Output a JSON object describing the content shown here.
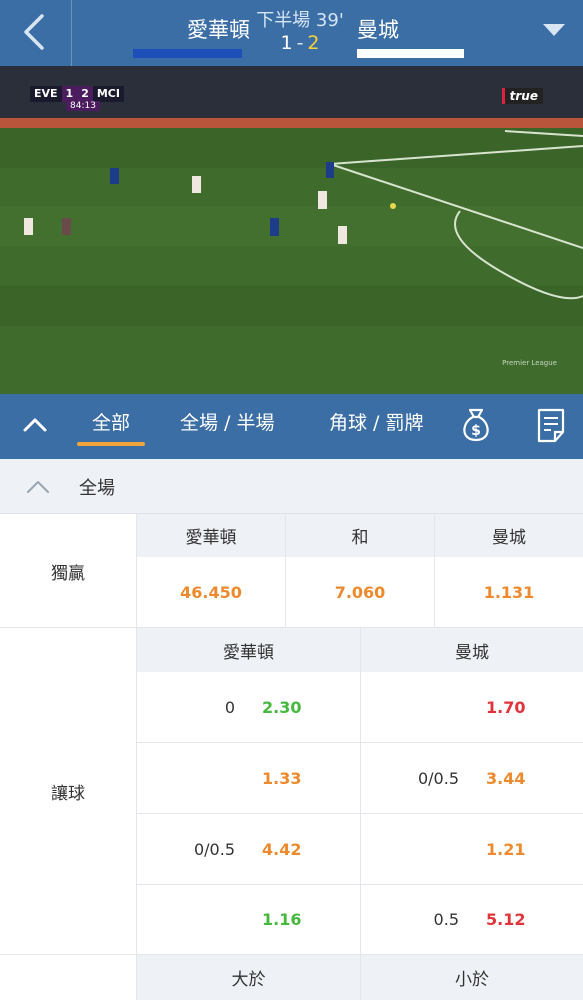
{
  "header": {
    "home_team": "愛華頓",
    "away_team": "曼城",
    "period": "下半場 39'",
    "home_score": "1",
    "score_sep": "-",
    "away_score": "2",
    "home_color": "#1e4fb8",
    "away_color": "#ffffff"
  },
  "video": {
    "score_bug": {
      "home": "EVE",
      "home_score": "1",
      "away_score": "2",
      "away": "MCI",
      "clock": "84:13"
    },
    "broadcaster": "true",
    "watermark": "Premier League"
  },
  "tabs": [
    {
      "label": "全部",
      "active": true
    },
    {
      "label": "全場 / 半場",
      "active": false
    },
    {
      "label": "角球 / 罰牌",
      "active": false
    }
  ],
  "toolbar_icons": [
    "collapse-chevron-icon",
    "money-bag-icon",
    "document-icon"
  ],
  "section": {
    "title": "全場"
  },
  "win_market": {
    "label": "獨贏",
    "headers": [
      "愛華頓",
      "和",
      "曼城"
    ],
    "odds": [
      "46.450",
      "7.060",
      "1.131"
    ]
  },
  "handicap_market": {
    "label": "讓球",
    "headers": [
      "愛華頓",
      "曼城"
    ],
    "rows": [
      {
        "home_line": "0",
        "home_odds": "2.30",
        "away_line": "",
        "away_odds": "1.70"
      },
      {
        "home_line": "",
        "home_odds": "1.33",
        "away_line": "0/0.5",
        "away_odds": "3.44"
      },
      {
        "home_line": "0/0.5",
        "home_odds": "4.42",
        "away_line": "",
        "away_odds": "1.21"
      },
      {
        "home_line": "",
        "home_odds": "1.16",
        "away_line": "0.5",
        "away_odds": "5.12"
      }
    ]
  },
  "total_market": {
    "headers": [
      "大於",
      "小於"
    ]
  },
  "colors": {
    "primary": "#3a6ea5",
    "accent": "#f0a53c",
    "odds_orange": "#ee8a2e",
    "odds_green": "#45b83d",
    "odds_red": "#e0343a"
  }
}
